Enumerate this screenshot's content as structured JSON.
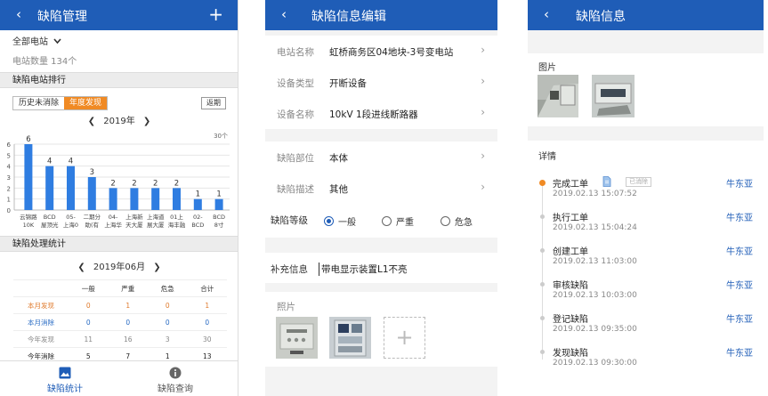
{
  "p1": {
    "header": {
      "back": "‹",
      "title": "缺陷管理",
      "add": "+"
    },
    "filter": "全部电站",
    "count_text": "电站数量 134个",
    "ranking_title": "缺陷电站排行",
    "toggle": [
      "历史未消除",
      "年度发现"
    ],
    "back_btn": "返期",
    "year_nav": "2019年",
    "stats_title": "缺陷处理统计",
    "month_nav": "2019年06月",
    "table": {
      "headers": [
        "",
        "一般",
        "严重",
        "危急",
        "合计"
      ],
      "rows": [
        {
          "label": "本月发现",
          "values": [
            "0",
            "1",
            "0",
            "1"
          ],
          "color": "#e07b2e"
        },
        {
          "label": "本月消除",
          "values": [
            "0",
            "0",
            "0",
            "0"
          ],
          "color": "#2a6cc4"
        },
        {
          "label": "今年发现",
          "values": [
            "11",
            "16",
            "3",
            "30"
          ],
          "color": "#888888"
        },
        {
          "label": "今年消除",
          "values": [
            "5",
            "7",
            "1",
            "13"
          ],
          "color": "#222222"
        }
      ]
    },
    "tabs": [
      {
        "label": "缺陷统计",
        "icon": "image-icon"
      },
      {
        "label": "缺陷查询",
        "icon": "info-icon"
      }
    ]
  },
  "chart_data": {
    "type": "bar",
    "categories": [
      [
        "云锦路",
        "10K"
      ],
      [
        "BCD",
        "屋顶光"
      ],
      [
        "05-",
        "上海0"
      ],
      [
        "二期分",
        "助(有"
      ],
      [
        "04-",
        "上海华"
      ],
      [
        "上海新",
        "天大厦"
      ],
      [
        "上海道",
        "展大厦"
      ],
      [
        "01上",
        "海丰融"
      ],
      [
        "02-",
        "BCD"
      ],
      [
        "BCD",
        "8寸"
      ]
    ],
    "values": [
      6,
      4,
      4,
      3,
      2,
      2,
      2,
      2,
      1,
      1
    ],
    "y_ticks": [
      "0",
      "1",
      "2",
      "3",
      "4",
      "5",
      "6"
    ],
    "ylim": [
      0,
      6
    ],
    "unit_label": "30个",
    "bar_color": "#2f7de1"
  },
  "p2": {
    "header": {
      "back": "‹",
      "title": "缺陷信息编辑"
    },
    "rows": [
      {
        "key": "电站名称",
        "value": "虹桥商务区04地块-3号变电站"
      },
      {
        "key": "设备类型",
        "value": "开断设备"
      },
      {
        "key": "设备名称",
        "value": "10kV 1段进线断路器"
      },
      {
        "key": "缺陷部位",
        "value": "本体"
      },
      {
        "key": "缺陷描述",
        "value": "其他"
      }
    ],
    "level": {
      "key": "缺陷等级",
      "options": [
        "一般",
        "严重",
        "危急"
      ]
    },
    "supplement": {
      "key": "补充信息",
      "value": "带电显示装置L1不亮"
    },
    "photos_label": "照片",
    "add_photo": "+"
  },
  "p3": {
    "header": {
      "back": "‹",
      "title": "缺陷信息"
    },
    "photos_label": "图片",
    "details_label": "详情",
    "timeline": [
      {
        "title": "完成工单",
        "date": "2019.02.13 15:07:52",
        "user": "牛东亚",
        "tag": "已消除"
      },
      {
        "title": "执行工单",
        "date": "2019.02.13 15:04:24",
        "user": "牛东亚"
      },
      {
        "title": "创建工单",
        "date": "2019.02.13 11:03:00",
        "user": "牛东亚"
      },
      {
        "title": "审核缺陷",
        "date": "2019.02.13 10:03:00",
        "user": "牛东亚"
      },
      {
        "title": "登记缺陷",
        "date": "2019.02.13 09:35:00",
        "user": "牛东亚"
      },
      {
        "title": "发现缺陷",
        "date": "2019.02.13 09:30:00",
        "user": "牛东亚"
      }
    ]
  }
}
